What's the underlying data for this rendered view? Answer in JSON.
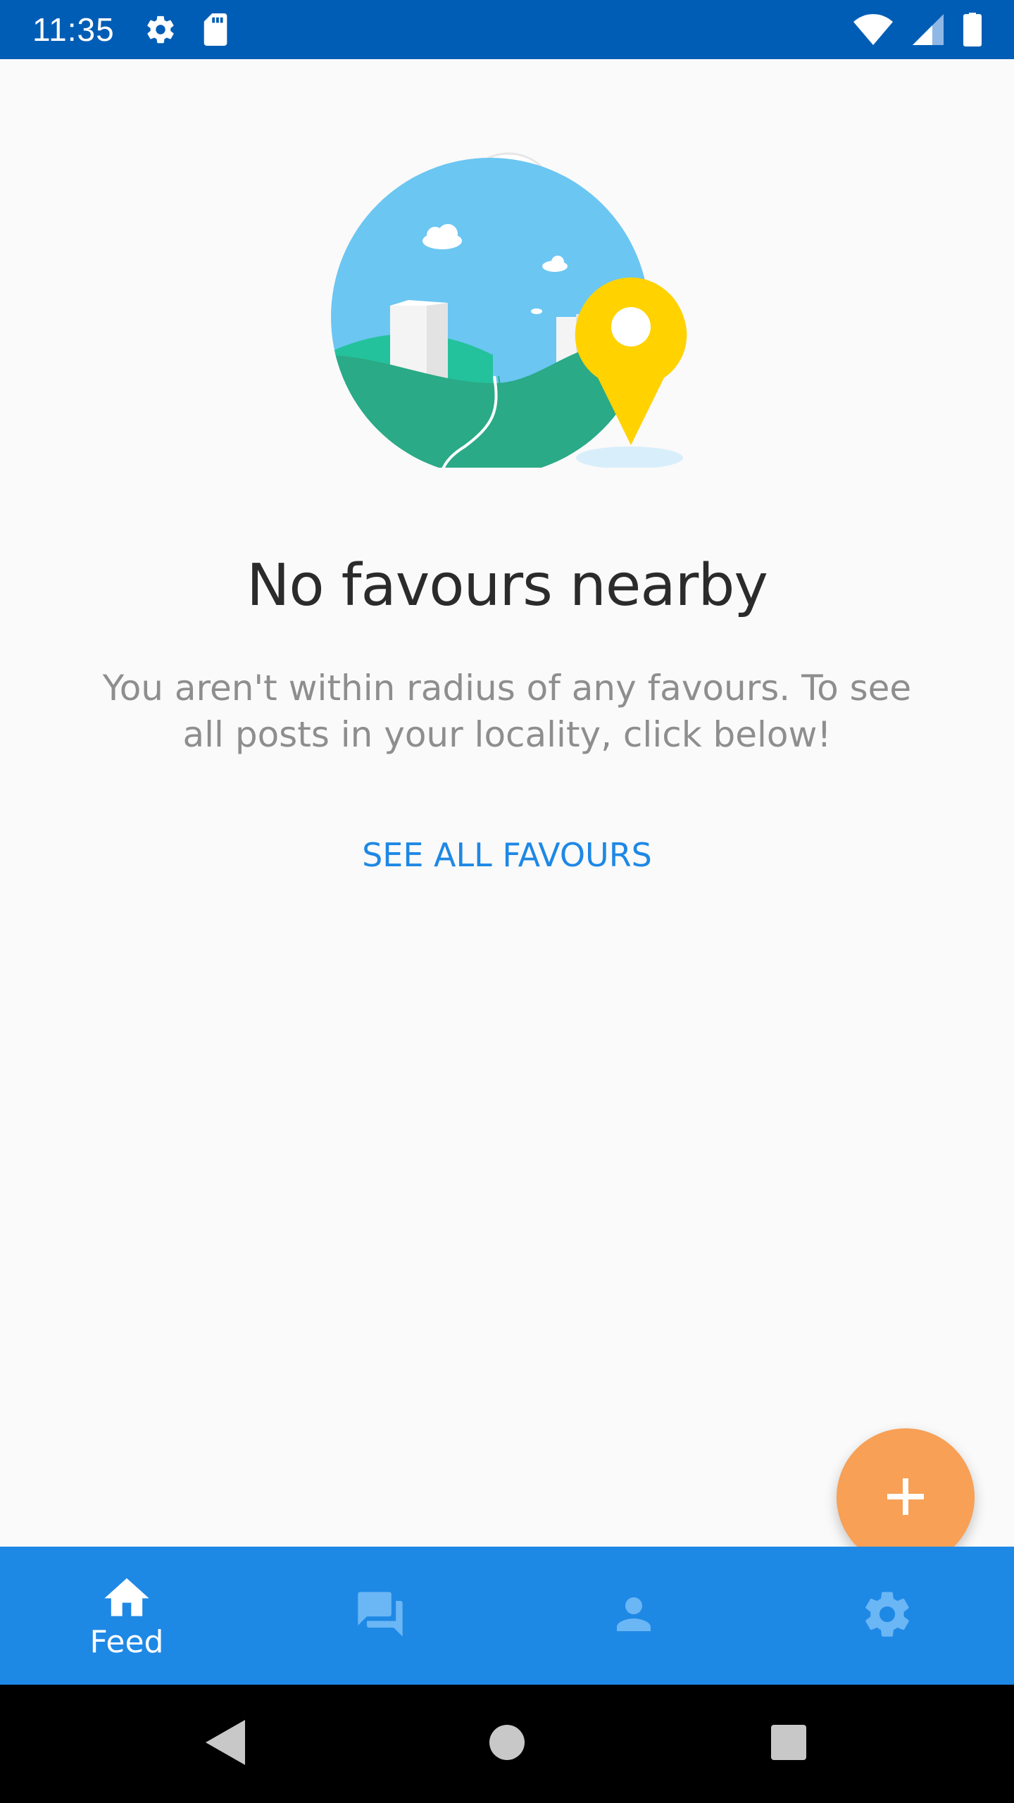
{
  "status_bar": {
    "time": "11:35",
    "icons": [
      "gear-icon",
      "sd-card-icon",
      "wifi-icon",
      "signal-icon",
      "battery-icon"
    ]
  },
  "empty_state": {
    "title": "No favours nearby",
    "message": "You aren't within radius of any favours. To see all posts in your locality, click below!",
    "action_label": "SEE ALL FAVOURS"
  },
  "fab": {
    "icon": "plus-icon"
  },
  "bottom_nav": {
    "items": [
      {
        "label": "Feed",
        "icon": "home-icon",
        "active": true
      },
      {
        "label": "",
        "icon": "chat-icon",
        "active": false
      },
      {
        "label": "",
        "icon": "person-icon",
        "active": false
      },
      {
        "label": "",
        "icon": "settings-icon",
        "active": false
      }
    ]
  },
  "system_nav": {
    "icons": [
      "back-icon",
      "home-circle-icon",
      "recents-icon"
    ]
  },
  "colors": {
    "status_bar": "#005db5",
    "accent": "#1e88e5",
    "fab": "#f7a056",
    "title": "#2b2b2b",
    "body": "#8e8e8e"
  }
}
